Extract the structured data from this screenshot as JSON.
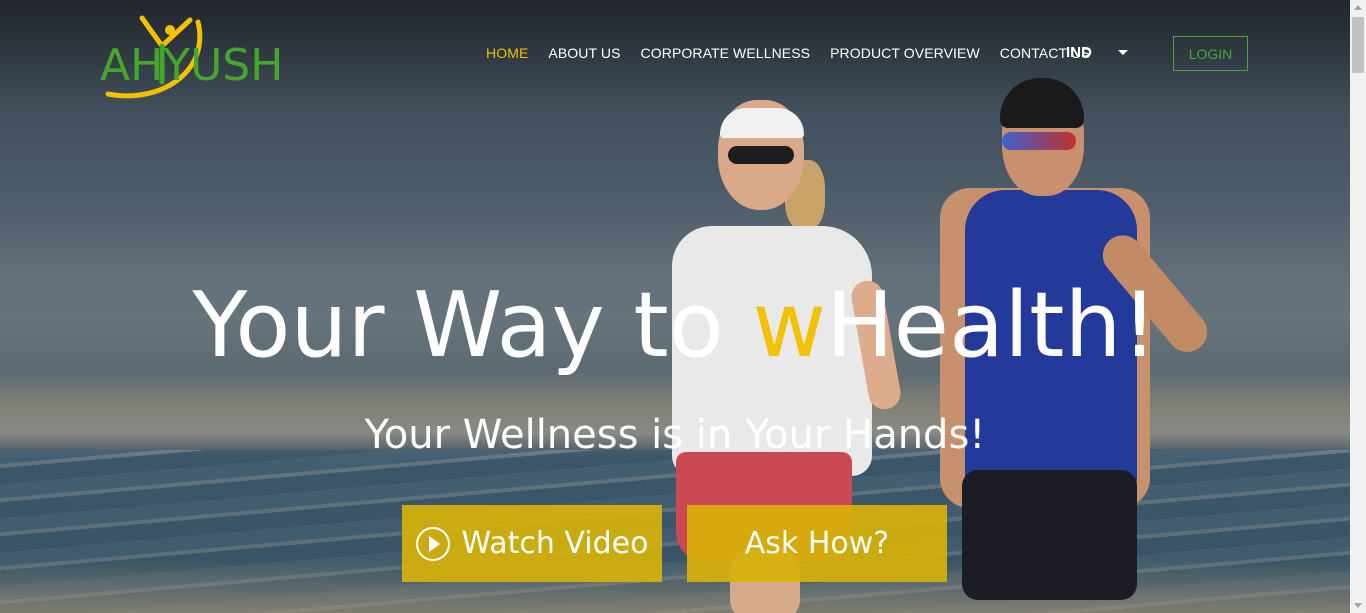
{
  "brand": {
    "logo_text": "AHYUSH"
  },
  "nav": {
    "items": [
      {
        "label": "HOME",
        "active": true
      },
      {
        "label": "ABOUT US",
        "active": false
      },
      {
        "label": "CORPORATE WELLNESS",
        "active": false
      },
      {
        "label": "PRODUCT OVERVIEW",
        "active": false
      },
      {
        "label": "CONTACT US",
        "active": false
      }
    ],
    "language": "IND",
    "login_label": "LOGIN"
  },
  "hero": {
    "headline_before": "Your Way to ",
    "headline_highlight": "w",
    "headline_after": "Health!",
    "subheadline": "Your Wellness is in Your Hands!",
    "watch_label": "Watch Video",
    "ask_label": "Ask How?"
  },
  "colors": {
    "accent": "#f2c100",
    "brand_green": "#45a52c",
    "button_bg": "#d7b20a"
  },
  "icons": {
    "play": "play-circle-icon",
    "dropdown": "caret-down-icon"
  }
}
